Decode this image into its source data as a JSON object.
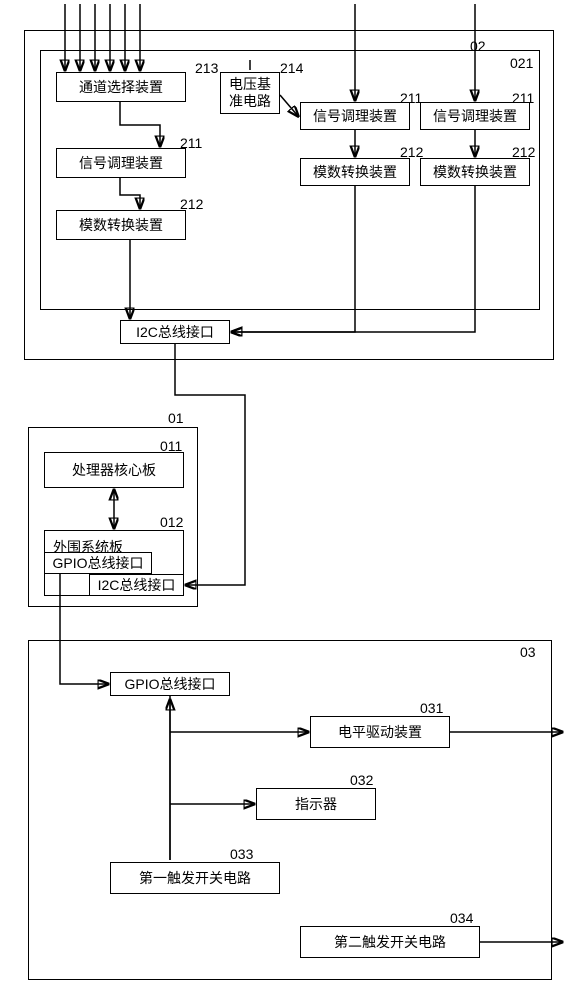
{
  "labels": {
    "outer02": "02",
    "inner021": "021",
    "b213_num": "213",
    "b213": "通道选择装置",
    "b214_num": "214",
    "b214_l1": "电压基",
    "b214_l2": "准电路",
    "b211a_num": "211",
    "b211a": "信号调理装置",
    "b212a_num": "212",
    "b212a": "模数转换装置",
    "b211b_num": "211",
    "b211b": "信号调理装置",
    "b212b_num": "212",
    "b212b": "模数转换装置",
    "b211c_num": "211",
    "b211c": "信号调理装置",
    "b212c_num": "212",
    "b212c": "模数转换装置",
    "i2c_021": "I2C总线接口",
    "outer01": "01",
    "b011_num": "011",
    "b011": "处理器核心板",
    "b012_num": "012",
    "b012": "外围系统板",
    "b012_gpio": "GPIO总线接口",
    "b012_i2c": "I2C总线接口",
    "outer03": "03",
    "b03_gpio": "GPIO总线接口",
    "b031_num": "031",
    "b031": "电平驱动装置",
    "b032_num": "032",
    "b032": "指示器",
    "b033_num": "033",
    "b033": "第一触发开关电路",
    "b034_num": "034",
    "b034": "第二触发开关电路"
  }
}
